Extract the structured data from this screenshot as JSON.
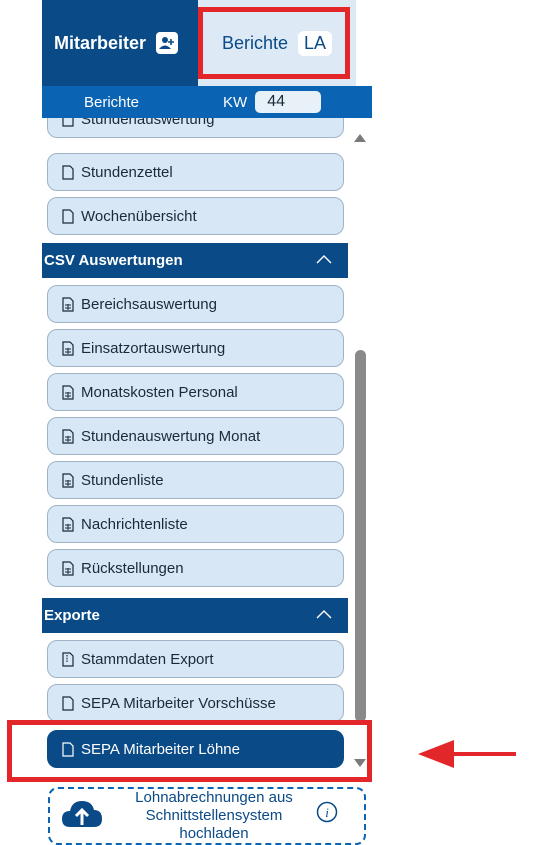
{
  "tabs": {
    "mitarbeiter_label": "Mitarbeiter",
    "berichte_label": "Berichte",
    "berichte_badge": "LA"
  },
  "subheader": {
    "title": "Berichte",
    "kw_label": "KW",
    "kw_value": "44"
  },
  "items_top": [
    {
      "label": "Stundenauswertung",
      "icon": "html-file-icon"
    },
    {
      "label": "Stundenzettel",
      "icon": "html-file-icon"
    },
    {
      "label": "Wochenübersicht",
      "icon": "html-file-icon"
    }
  ],
  "sections": {
    "csv_title": "CSV Auswertungen",
    "exporte_title": "Exporte"
  },
  "items_csv": [
    {
      "label": "Bereichsauswertung",
      "icon": "csv-file-icon"
    },
    {
      "label": "Einsatzortauswertung",
      "icon": "csv-file-icon"
    },
    {
      "label": "Monatskosten Personal",
      "icon": "csv-file-icon"
    },
    {
      "label": "Stundenauswertung Monat",
      "icon": "csv-file-icon"
    },
    {
      "label": "Stundenliste",
      "icon": "csv-file-icon"
    },
    {
      "label": "Nachrichtenliste",
      "icon": "csv-file-icon"
    },
    {
      "label": "Rückstellungen",
      "icon": "csv-file-icon"
    }
  ],
  "items_export": [
    {
      "label": "Stammdaten Export",
      "icon": "zip-file-icon"
    },
    {
      "label": "SEPA Mitarbeiter Vorschüsse",
      "icon": "xml-file-icon"
    },
    {
      "label": "SEPA Mitarbeiter Löhne",
      "icon": "xml-file-icon",
      "active": true
    }
  ],
  "upload": {
    "line1": "Lohnabrechnungen aus",
    "line2": "Schnittstellensystem",
    "line3": "hochladen"
  },
  "colors": {
    "primary": "#0a4a86",
    "secondary": "#0a64b3",
    "item_bg": "#d8e7f5",
    "highlight": "#e3262a"
  }
}
